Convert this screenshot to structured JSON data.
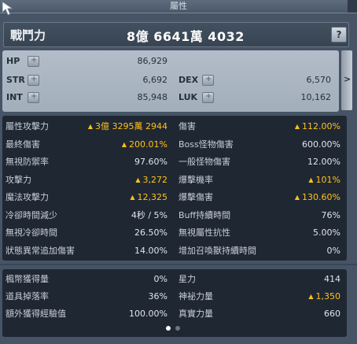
{
  "window": {
    "title": "屬性"
  },
  "combat_power": {
    "label": "戰鬥力",
    "value": "8億 6641萬 4032",
    "help": "?"
  },
  "base_stats": [
    {
      "label": "HP",
      "value": "86,929"
    },
    {
      "label": "STR",
      "value": "6,692"
    },
    {
      "label": "DEX",
      "value": "6,570"
    },
    {
      "label": "INT",
      "value": "85,948"
    },
    {
      "label": "LUK",
      "value": "10,162"
    }
  ],
  "button_glyph": "+",
  "expand_glyph": ">",
  "detail_stats": {
    "left": [
      {
        "label": "屬性攻擊力",
        "arrow": "▲",
        "value": "3億 3295萬 2944",
        "highlight": true
      },
      {
        "label": "最終傷害",
        "arrow": "▲",
        "value": "200.01%",
        "highlight": true
      },
      {
        "label": "無視防禦率",
        "value": "97.60%"
      },
      {
        "label": "攻擊力",
        "arrow": "▲",
        "value": "3,272",
        "highlight": true
      },
      {
        "label": "魔法攻擊力",
        "arrow": "▲",
        "value": "12,325",
        "highlight": true
      },
      {
        "label": "冷卻時間減少",
        "value": "4秒 / 5%"
      },
      {
        "label": "無視冷卻時間",
        "value": "26.50%"
      },
      {
        "label": "狀態異常追加傷害",
        "value": "14.00%"
      }
    ],
    "right": [
      {
        "label": "傷害",
        "arrow": "▲",
        "value": "112.00%",
        "highlight": true
      },
      {
        "label": "Boss怪物傷害",
        "value": "600.00%"
      },
      {
        "label": "一般怪物傷害",
        "value": "12.00%"
      },
      {
        "label": "爆擊機率",
        "arrow": "▲",
        "value": "101%",
        "highlight": true
      },
      {
        "label": "爆擊傷害",
        "arrow": "▲",
        "value": "130.60%",
        "highlight": true
      },
      {
        "label": "Buff持續時間",
        "value": "76%"
      },
      {
        "label": "無視屬性抗性",
        "value": "5.00%"
      },
      {
        "label": "增加召喚獸持續時間",
        "value": "0%"
      }
    ]
  },
  "etc_stats": {
    "left": [
      {
        "label": "楓幣獲得量",
        "value": "0%"
      },
      {
        "label": "道具掉落率",
        "value": "36%"
      },
      {
        "label": "額外獲得經驗值",
        "value": "100.00%"
      }
    ],
    "right": [
      {
        "label": "星力",
        "value": "414"
      },
      {
        "label": "神祕力量",
        "arrow": "▲",
        "value": "1,350",
        "highlight": true
      },
      {
        "label": "真實力量",
        "value": "660"
      }
    ]
  },
  "colors": {
    "highlight": "#ffc21a",
    "panel_dark": "#1f2733",
    "panel_light": "#aab5c2"
  }
}
